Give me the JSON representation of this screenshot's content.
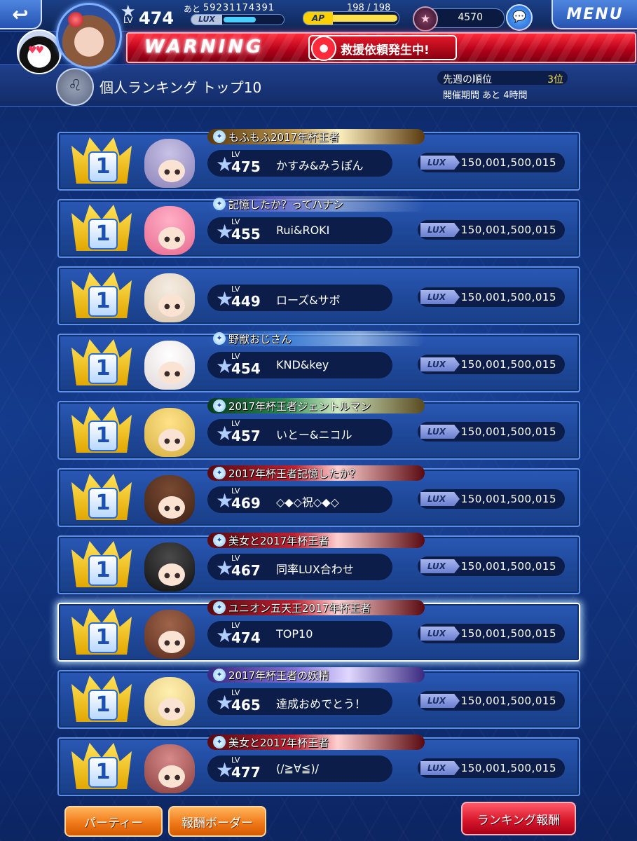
{
  "header": {
    "back_icon": "back-arrow-icon",
    "level_label": "LV",
    "level": "474",
    "lux_remaining_label": "あと",
    "lux_remaining": "59231174391",
    "lux_tag": "LUX",
    "lux_progress": 0.55,
    "ap_tag": "AP",
    "ap_value": "198 / 198",
    "ap_progress": 1.0,
    "jewels": "4570",
    "menu_label": "MENU"
  },
  "warning": {
    "text": "WARNING",
    "rescue_text": "救援依頼発生中!"
  },
  "section": {
    "title": "個人ランキング トップ10",
    "last_week_label": "先週の順位",
    "last_week_value": "3位",
    "period": "開催期間 あと 4時間"
  },
  "ranking": [
    {
      "rank": "1",
      "title": "もふもふ2017年杯王者",
      "title_style": "gold",
      "level_label": "LV",
      "level": "475",
      "name": "かすみ&みうぽん",
      "lux_tag": "LUX",
      "lux": "150,001,500,015",
      "avatar": "lilac"
    },
    {
      "rank": "1",
      "title": "記憶したか？ってハナシ",
      "title_style": "stars",
      "level_label": "LV",
      "level": "455",
      "name": "Rui&ROKI",
      "lux_tag": "LUX",
      "lux": "150,001,500,015",
      "avatar": "pink"
    },
    {
      "rank": "1",
      "title": "",
      "title_style": "",
      "level_label": "LV",
      "level": "449",
      "name": "ローズ&サボ",
      "lux_tag": "LUX",
      "lux": "150,001,500,015",
      "avatar": "cream"
    },
    {
      "rank": "1",
      "title": "野獣おじさん",
      "title_style": "hearts",
      "level_label": "LV",
      "level": "454",
      "name": "KND&key",
      "lux_tag": "LUX",
      "lux": "150,001,500,015",
      "avatar": "white"
    },
    {
      "rank": "1",
      "title": "2017年杯王者ジェントルマン",
      "title_style": "green",
      "level_label": "LV",
      "level": "457",
      "name": "いとー&ニコル",
      "lux_tag": "LUX",
      "lux": "150,001,500,015",
      "avatar": "blond"
    },
    {
      "rank": "1",
      "title": "2017年杯王者記憶したか？",
      "title_style": "red",
      "level_label": "LV",
      "level": "469",
      "name": "◇◆◇祝◇◆◇",
      "lux_tag": "LUX",
      "lux": "150,001,500,015",
      "avatar": "brown"
    },
    {
      "rank": "1",
      "title": "美女と2017年杯王者",
      "title_style": "red",
      "level_label": "LV",
      "level": "467",
      "name": "同率LUX合わせ",
      "lux_tag": "LUX",
      "lux": "150,001,500,015",
      "avatar": "black"
    },
    {
      "rank": "1",
      "title": "ユニオン五天王2017年杯王者",
      "title_style": "red",
      "level_label": "LV",
      "level": "474",
      "name": "TOP10",
      "lux_tag": "LUX",
      "lux": "150,001,500,015",
      "avatar": "auburn",
      "self": true
    },
    {
      "rank": "1",
      "title": "2017年杯王者の妖精",
      "title_style": "violet",
      "level_label": "LV",
      "level": "465",
      "name": "達成おめでとう！",
      "lux_tag": "LUX",
      "lux": "150,001,500,015",
      "avatar": "gold"
    },
    {
      "rank": "1",
      "title": "美女と2017年杯王者",
      "title_style": "red",
      "level_label": "LV",
      "level": "477",
      "name": "(/≧∀≦)/",
      "lux_tag": "LUX",
      "lux": "150,001,500,015",
      "avatar": "rose"
    }
  ],
  "footer": {
    "party_label": "パーティー",
    "reward_border_label": "報酬ボーダー",
    "ranking_reward_label": "ランキング報酬"
  }
}
